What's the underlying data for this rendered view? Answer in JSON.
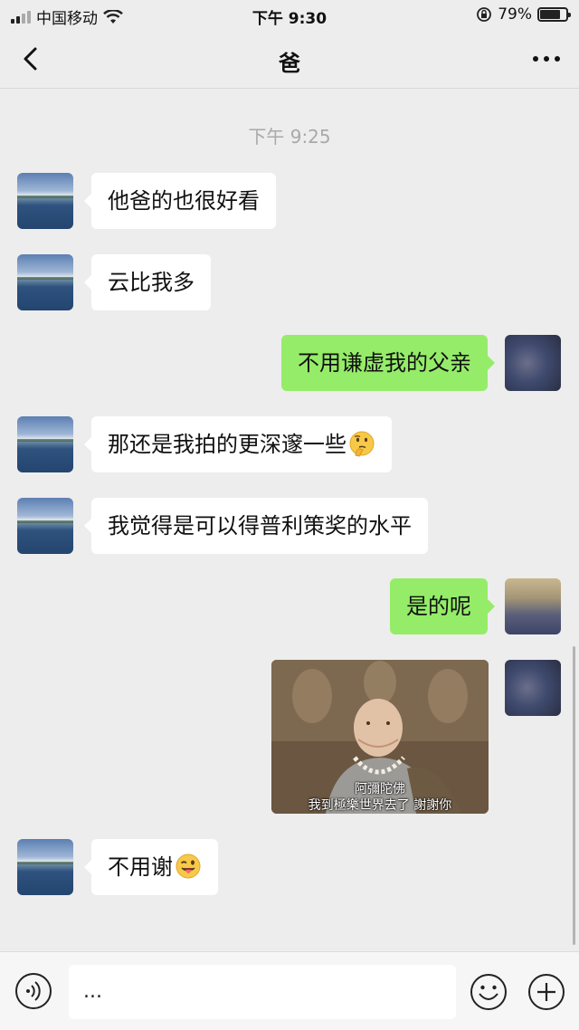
{
  "status_bar": {
    "carrier": "中国移动",
    "time": "下午 9:30",
    "battery": "79%",
    "battery_level": 0.79
  },
  "nav": {
    "title": "爸"
  },
  "chat": {
    "timestamp": "下午 9:25",
    "messages": [
      {
        "side": "in",
        "text": "他爸的也很好看"
      },
      {
        "side": "in",
        "text": "云比我多"
      },
      {
        "side": "out",
        "text": "不用谦虚我的父亲"
      },
      {
        "side": "in",
        "text": "那还是我拍的更深邃一些",
        "emoji": "thinking-face-icon"
      },
      {
        "side": "in",
        "text": "我觉得是可以得普利策奖的水平"
      },
      {
        "side": "out",
        "text": "是的呢"
      },
      {
        "side": "out",
        "image": true,
        "caption_line1": "阿彌陀佛",
        "caption_line2": "我到極樂世界去了  謝謝你"
      },
      {
        "side": "in",
        "text": "不用谢",
        "emoji": "winking-tongue-face-icon"
      }
    ]
  },
  "input": {
    "value": "..."
  },
  "colors": {
    "outgoing_bubble": "#95ec69",
    "incoming_bubble": "#ffffff",
    "background": "#ededed"
  }
}
